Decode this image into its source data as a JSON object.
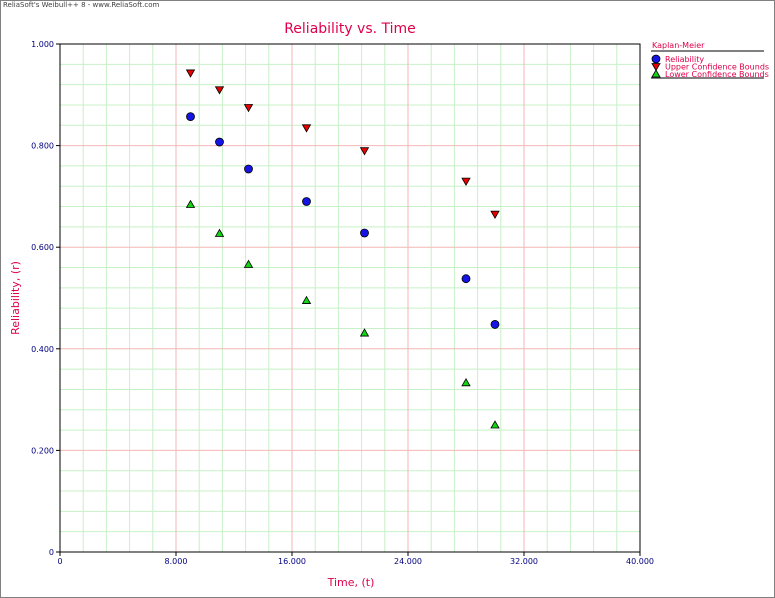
{
  "watermark": "ReliaSoft's Weibull++ 8 - www.ReliaSoft.com",
  "colors": {
    "title": "#e0004a",
    "tick": "#000080",
    "major_grid": "#f4b7b7",
    "minor_grid": "#c8f0c8",
    "reliability": "#1414e6",
    "upper": "#e60000",
    "lower": "#14d214"
  },
  "chart_data": {
    "type": "scatter",
    "title": "Reliability vs. Time",
    "xlabel": "Time, (t)",
    "ylabel": "Reliability, (r)",
    "xlim": [
      0,
      40
    ],
    "ylim": [
      0,
      1
    ],
    "grid": true,
    "x_ticks": [
      0,
      8,
      16,
      24,
      32,
      40
    ],
    "x_tick_labels": [
      "0",
      "8.000",
      "16.000",
      "24.000",
      "32.000",
      "40.000"
    ],
    "y_ticks": [
      0,
      0.2,
      0.4,
      0.6,
      0.8,
      1.0
    ],
    "y_tick_labels": [
      "0",
      "0.200",
      "0.400",
      "0.600",
      "0.800",
      "1.000"
    ],
    "legend_title": "Kaplan-Meier",
    "legend_position": "top-right",
    "series": [
      {
        "name": "Reliability",
        "marker": "circle",
        "color": "#1414e6",
        "x": [
          9,
          11,
          13,
          17,
          21,
          28,
          30
        ],
        "y": [
          0.857,
          0.807,
          0.754,
          0.69,
          0.628,
          0.538,
          0.448
        ]
      },
      {
        "name": "Upper Confidence Bounds",
        "marker": "triangle-down",
        "color": "#e60000",
        "x": [
          9,
          11,
          13,
          17,
          21,
          28,
          30
        ],
        "y": [
          0.943,
          0.91,
          0.875,
          0.835,
          0.79,
          0.73,
          0.665
        ]
      },
      {
        "name": "Lower Confidence Bounds",
        "marker": "triangle-up",
        "color": "#14d214",
        "x": [
          9,
          11,
          13,
          17,
          21,
          28,
          30
        ],
        "y": [
          0.684,
          0.627,
          0.566,
          0.495,
          0.431,
          0.333,
          0.25
        ]
      }
    ]
  }
}
